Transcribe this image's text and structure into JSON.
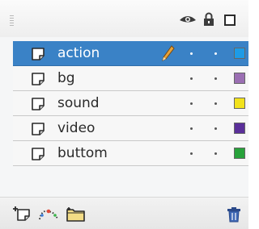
{
  "header": {
    "icons": [
      "eye-icon",
      "lock-icon",
      "outline-icon"
    ]
  },
  "layers": [
    {
      "name": "action",
      "selected": true,
      "editing": true,
      "color": "#1e9be6"
    },
    {
      "name": "bg",
      "selected": false,
      "editing": false,
      "color": "#9b6fb3"
    },
    {
      "name": "sound",
      "selected": false,
      "editing": false,
      "color": "#f2e21c"
    },
    {
      "name": "video",
      "selected": false,
      "editing": false,
      "color": "#5b2f9a"
    },
    {
      "name": "buttom",
      "selected": false,
      "editing": false,
      "color": "#28a23b"
    }
  ],
  "footer": {
    "icons": [
      "new-layer-icon",
      "add-motion-guide-icon",
      "new-folder-icon",
      "trash-icon"
    ]
  },
  "colors": {
    "selection": "#3a82c6",
    "panel": "#f5f6f7"
  }
}
